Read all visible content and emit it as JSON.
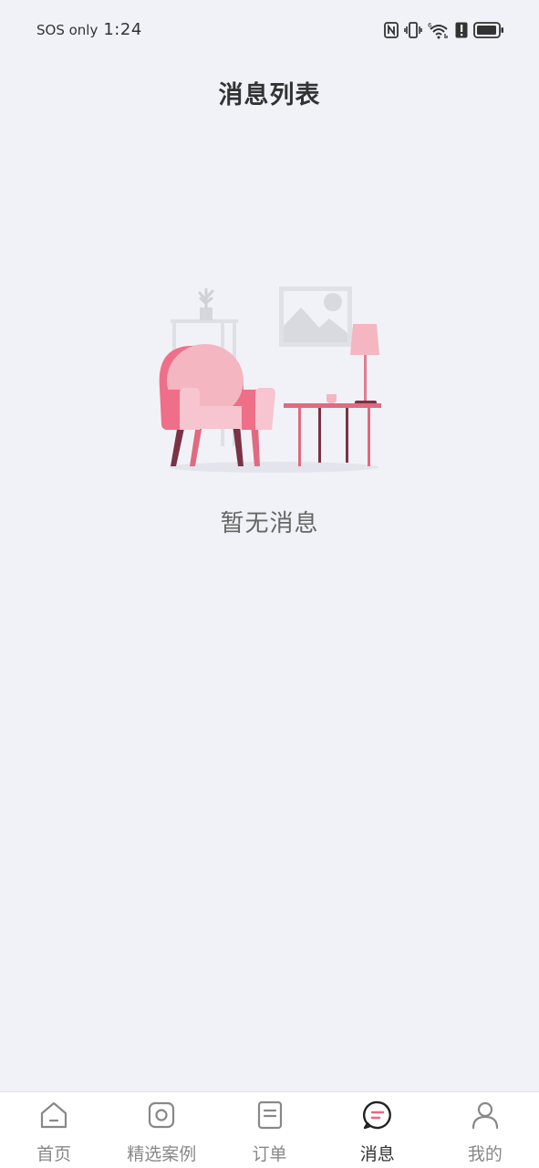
{
  "status_bar": {
    "carrier": "SOS only",
    "time": "1:24"
  },
  "header": {
    "title": "消息列表"
  },
  "empty_state": {
    "text": "暂无消息"
  },
  "tab_bar": {
    "items": [
      {
        "label": "首页",
        "icon": "home-icon",
        "active": false
      },
      {
        "label": "精选案例",
        "icon": "camera-icon",
        "active": false
      },
      {
        "label": "订单",
        "icon": "order-icon",
        "active": false
      },
      {
        "label": "消息",
        "icon": "message-icon",
        "active": true
      },
      {
        "label": "我的",
        "icon": "profile-icon",
        "active": false
      }
    ]
  },
  "colors": {
    "background": "#f1f2f7",
    "accent": "#f06483",
    "text_primary": "#333333",
    "text_secondary": "#888888"
  }
}
